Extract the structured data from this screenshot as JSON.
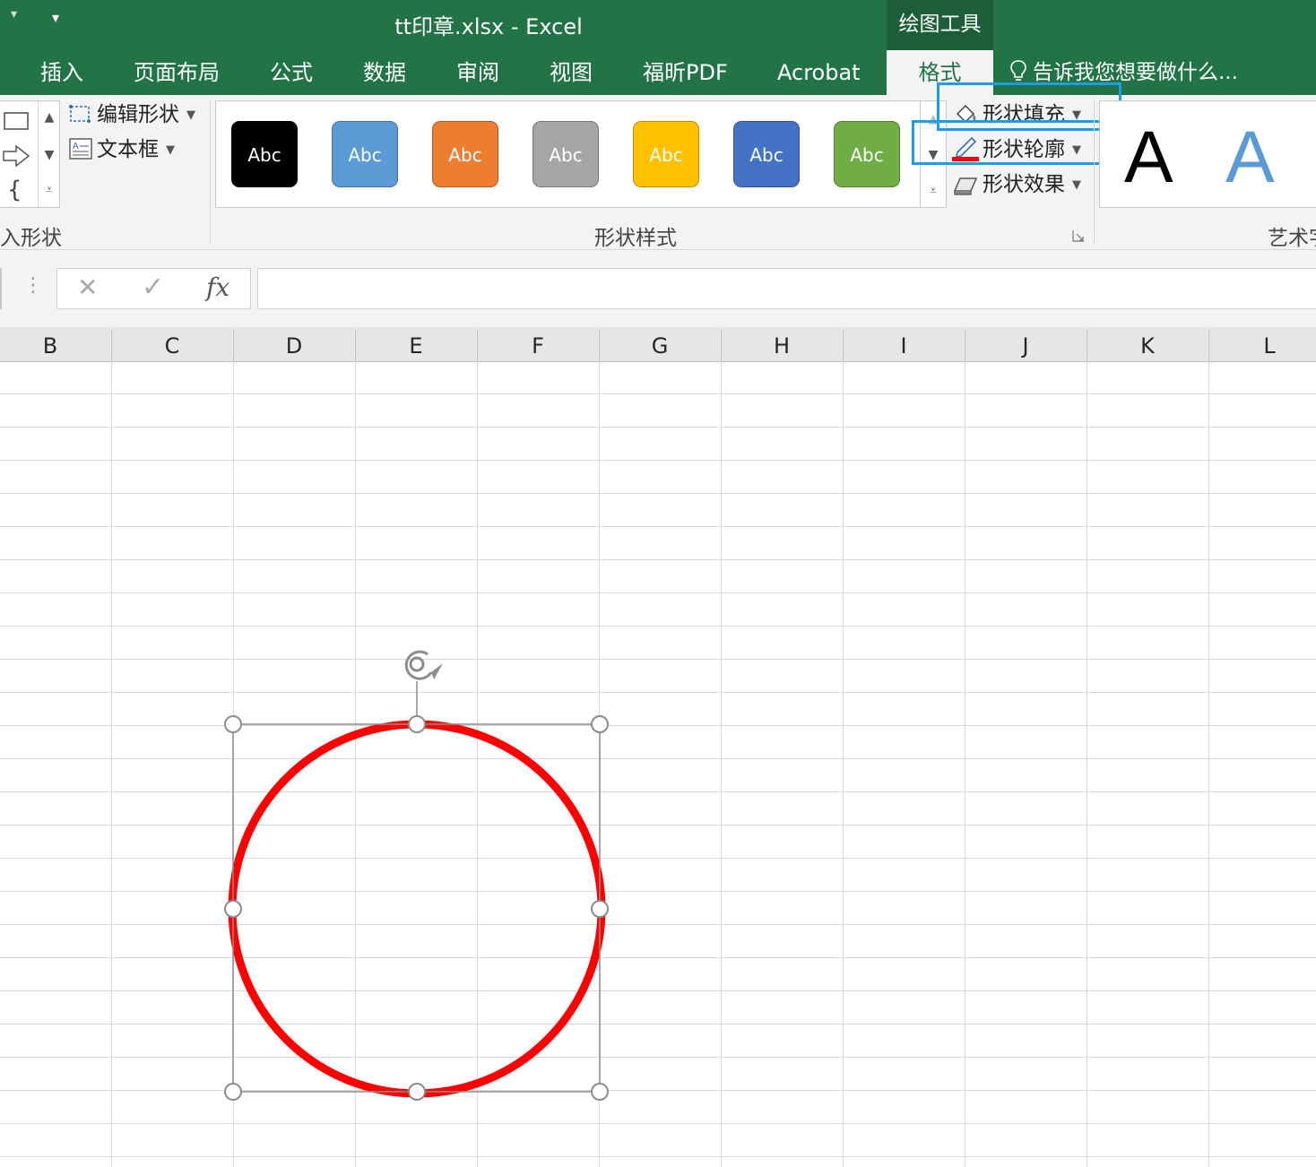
{
  "window": {
    "title": "tt印章.xlsx - Excel",
    "contextual_tab_group": "绘图工具"
  },
  "tabs": [
    {
      "label": "插入"
    },
    {
      "label": "页面布局"
    },
    {
      "label": "公式"
    },
    {
      "label": "数据"
    },
    {
      "label": "审阅"
    },
    {
      "label": "视图"
    },
    {
      "label": "福昕PDF"
    },
    {
      "label": "Acrobat"
    },
    {
      "label": "格式",
      "active": true
    }
  ],
  "tell_me": "告诉我您想要做什么...",
  "ribbon": {
    "insert_shapes": {
      "edit_shape": "编辑形状",
      "text_box": "文本框",
      "group_label": "入形状"
    },
    "shape_styles": {
      "presets": [
        {
          "label": "Abc",
          "fill": "#000000",
          "border": "#000000"
        },
        {
          "label": "Abc",
          "fill": "#5b9bd5",
          "border": "#41719c"
        },
        {
          "label": "Abc",
          "fill": "#ed7d31",
          "border": "#ae5a21"
        },
        {
          "label": "Abc",
          "fill": "#a5a5a5",
          "border": "#787878"
        },
        {
          "label": "Abc",
          "fill": "#ffc000",
          "border": "#bc8c00"
        },
        {
          "label": "Abc",
          "fill": "#4472c4",
          "border": "#2f528f"
        },
        {
          "label": "Abc",
          "fill": "#70ad47",
          "border": "#507e32"
        }
      ],
      "shape_fill": "形状填充",
      "shape_outline": "形状轮廓",
      "shape_effects": "形状效果",
      "group_label": "形状样式"
    },
    "wordart": {
      "samples": [
        {
          "char": "A",
          "color": "#000000"
        },
        {
          "char": "A",
          "color": "#5b9bd5"
        }
      ],
      "group_label": "艺术字"
    }
  },
  "formula_bar": {
    "cancel_icon": "✕",
    "enter_icon": "✓",
    "fx_label": "fx",
    "content": ""
  },
  "columns": [
    "B",
    "C",
    "D",
    "E",
    "F",
    "G",
    "H",
    "I",
    "J",
    "K",
    "L"
  ],
  "shape": {
    "type": "circle",
    "outline_color": "#ff0000",
    "fill": "none",
    "selected": true
  },
  "colors": {
    "excel_green": "#227447",
    "highlight_box": "#1a9ee8"
  }
}
